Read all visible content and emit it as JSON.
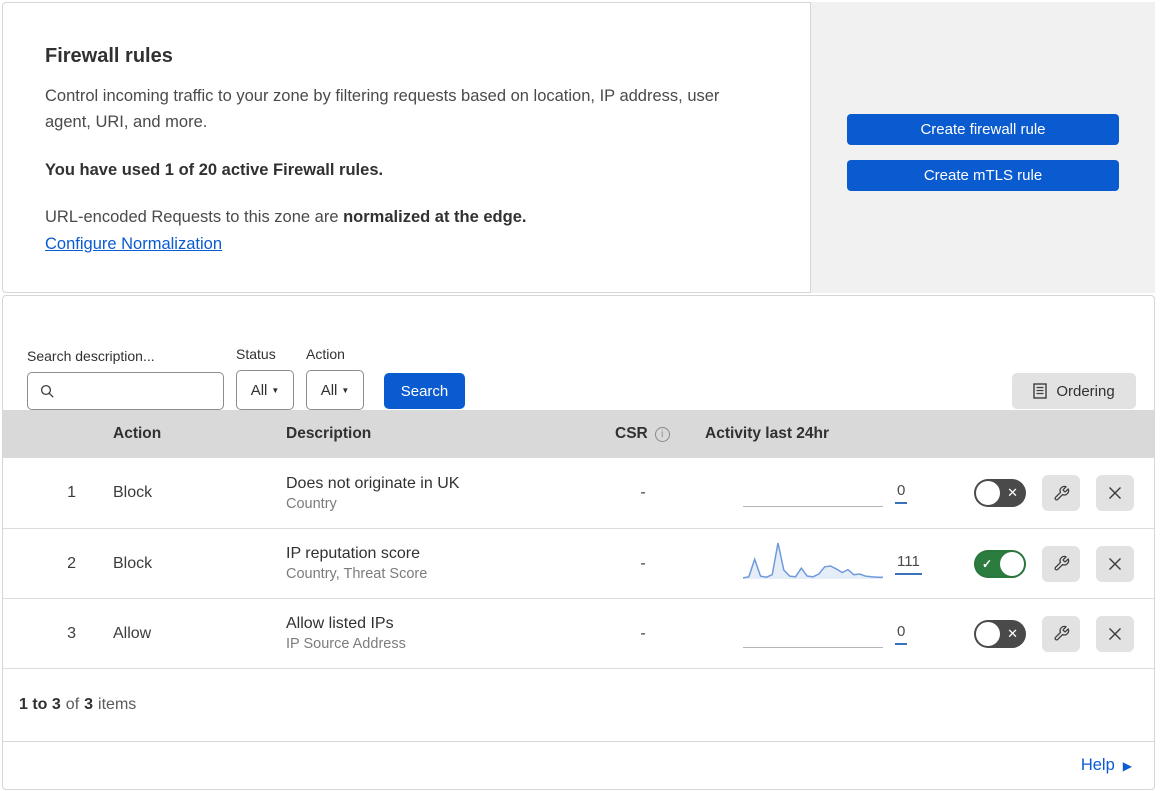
{
  "intro": {
    "title": "Firewall rules",
    "description": "Control incoming traffic to your zone by filtering requests based on location, IP address, user agent, URI, and more.",
    "usage_notice": "You have used 1 of 20 active Firewall rules.",
    "normalization_prefix": "URL-encoded Requests to this zone are ",
    "normalization_bold": "normalized at the edge.",
    "normalization_link": "Configure Normalization"
  },
  "actions": {
    "create_firewall_rule": "Create firewall rule",
    "create_mtls_rule": "Create mTLS rule"
  },
  "filters": {
    "search_label": "Search description...",
    "search_value": "",
    "status_label": "Status",
    "status_value": "All",
    "action_label": "Action",
    "action_value": "All",
    "search_button": "Search",
    "ordering_button": "Ordering"
  },
  "table": {
    "headers": {
      "action": "Action",
      "description": "Description",
      "csr": "CSR",
      "activity": "Activity last 24hr"
    },
    "rows": [
      {
        "num": "1",
        "action": "Block",
        "title": "Does not originate in UK",
        "subtitle": "Country",
        "csr": "-",
        "activity_count": "0",
        "enabled": false,
        "sparkline_values": null
      },
      {
        "num": "2",
        "action": "Block",
        "title": "IP reputation score",
        "subtitle": "Country, Threat Score",
        "csr": "-",
        "activity_count": "111",
        "enabled": true,
        "sparkline_values": [
          3,
          6,
          55,
          8,
          5,
          12,
          100,
          25,
          8,
          6,
          30,
          8,
          6,
          14,
          34,
          36,
          28,
          18,
          26,
          12,
          14,
          8,
          6,
          5,
          5
        ]
      },
      {
        "num": "3",
        "action": "Allow",
        "title": "Allow listed IPs",
        "subtitle": "IP Source Address",
        "csr": "-",
        "activity_count": "0",
        "enabled": false,
        "sparkline_values": null
      }
    ]
  },
  "footer": {
    "range": "1 to 3",
    "of_word": "of",
    "total": "3",
    "items_word": "items"
  },
  "help": {
    "label": "Help"
  },
  "colors": {
    "accent_blue": "#0b5bd0",
    "toggle_on_green": "#2c7c40",
    "toggle_off_gray": "#4a4a4a",
    "sparkline_blue": "#6f9bdb",
    "table_header_bg": "#d9d9d9",
    "panel_gray": "#f1f1f1"
  }
}
